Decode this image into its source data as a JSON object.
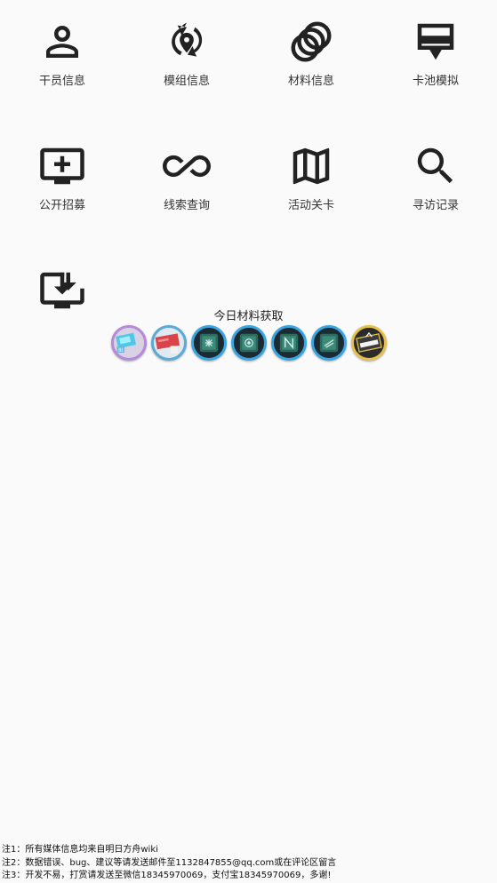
{
  "menu": [
    {
      "label": "干员信息",
      "icon": "person-icon"
    },
    {
      "label": "模组信息",
      "icon": "module-icon"
    },
    {
      "label": "材料信息",
      "icon": "rings-icon"
    },
    {
      "label": "卡池模拟",
      "icon": "card-pool-icon"
    },
    {
      "label": "公开招募",
      "icon": "add-screen-icon"
    },
    {
      "label": "线索查询",
      "icon": "infinity-icon"
    },
    {
      "label": "活动关卡",
      "icon": "map-icon"
    },
    {
      "label": "寻访记录",
      "icon": "search-icon"
    },
    {
      "label": "",
      "icon": "download-icon"
    }
  ],
  "today": {
    "title": "今日材料获取",
    "materials": [
      {
        "icon": "skill-chip-purple-icon",
        "ring": "#b78ad8"
      },
      {
        "icon": "red-ticket-icon",
        "ring": "#5aa9d6"
      },
      {
        "icon": "chip-blue-1-icon",
        "ring": "#3aa6e0"
      },
      {
        "icon": "chip-blue-2-icon",
        "ring": "#3aa6e0"
      },
      {
        "icon": "chip-blue-3-icon",
        "ring": "#3aa6e0"
      },
      {
        "icon": "chip-blue-4-icon",
        "ring": "#3aa6e0"
      },
      {
        "icon": "exp-card-gold-icon",
        "ring": "#e5c04a"
      }
    ]
  },
  "notes": [
    "注1：所有媒体信息均来自明日方舟wiki",
    "注2：数据错误、bug、建议等请发送邮件至1132847855@qq.com或在评论区留言",
    "注3：开发不易，打赏请发送至微信18345970069，支付宝18345970069，多谢!"
  ]
}
